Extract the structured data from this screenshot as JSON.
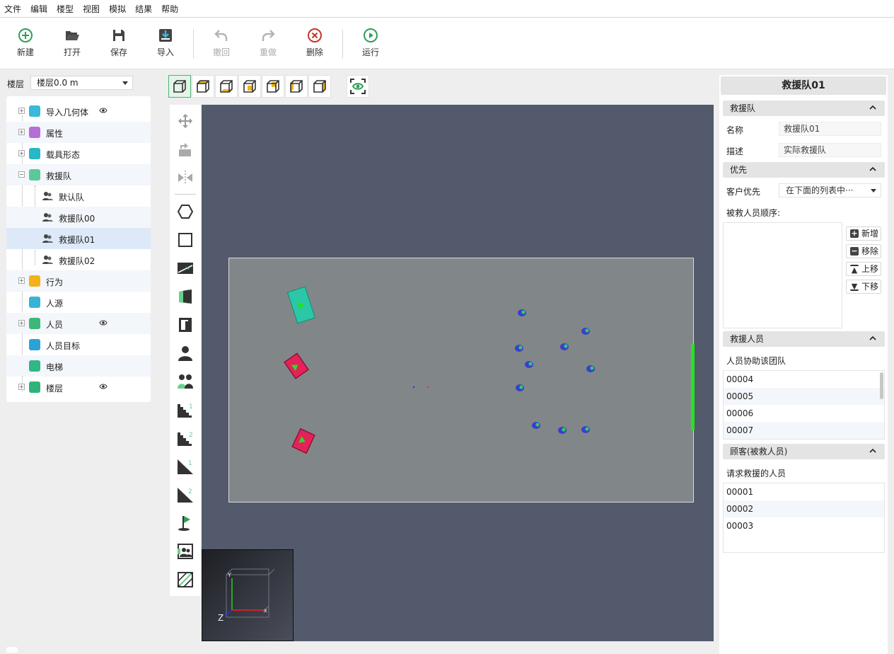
{
  "menu": [
    "文件",
    "编辑",
    "楼型",
    "视图",
    "模拟",
    "结果",
    "帮助"
  ],
  "toolbar": {
    "new": "新建",
    "open": "打开",
    "save": "保存",
    "import": "导入",
    "undo": "撤回",
    "redo": "重做",
    "delete": "删除",
    "run": "运行"
  },
  "floor": {
    "label": "楼层",
    "value": "楼层0.0 m"
  },
  "tree": [
    {
      "label": "导入几何体",
      "color": "#3cb8d8",
      "eye": true
    },
    {
      "label": "属性",
      "color": "#b56fd6"
    },
    {
      "label": "载具形态",
      "color": "#28b7c4"
    },
    {
      "label": "救援队",
      "color": "#5bc89a"
    },
    {
      "label": "默认队",
      "child": true
    },
    {
      "label": "救援队00",
      "child": true
    },
    {
      "label": "救援队01",
      "child": true
    },
    {
      "label": "救援队02",
      "child": true
    },
    {
      "label": "行为",
      "color": "#f2b21a"
    },
    {
      "label": "人源",
      "color": "#38b3d6"
    },
    {
      "label": "人员",
      "color": "#3db87a",
      "eye": true
    },
    {
      "label": "人员目标",
      "color": "#2ba3d8"
    },
    {
      "label": "电梯",
      "color": "#32b685"
    },
    {
      "label": "楼层",
      "color": "#2fb37a",
      "eye": true
    }
  ],
  "panel": {
    "title": "救援队01",
    "sec_team": "救援队",
    "name_label": "名称",
    "name_value": "救援队01",
    "desc_label": "描述",
    "desc_value": "实际救援队",
    "sec_priority": "优先",
    "customer_priority_label": "客户优先",
    "customer_priority_value": "在下面的列表中···",
    "rescued_order_label": "被救人员顺序:",
    "btn_add": "新增",
    "btn_remove": "移除",
    "btn_up": "上移",
    "btn_down": "下移",
    "sec_rescuers": "救援人员",
    "rescuers_note": "人员协助该团队",
    "rescuers": [
      "00004",
      "00005",
      "00006",
      "00007"
    ],
    "sec_customers": "顾客(被救人员)",
    "customers_note": "请求救援的人员",
    "customers": [
      "00001",
      "00002",
      "00003"
    ]
  },
  "axes": {
    "x": "x",
    "y": "Y",
    "z": "Z"
  },
  "colors": {
    "canvas": "#535a6c",
    "floor": "#818789",
    "exit": "#27e224",
    "accent": "#49b56f"
  }
}
